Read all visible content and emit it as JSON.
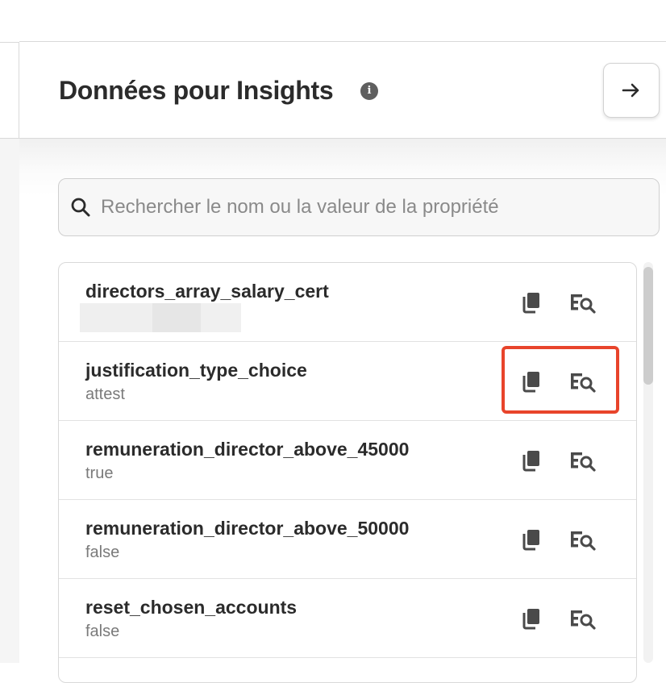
{
  "panel": {
    "title": "Données pour Insights",
    "info_glyph": "i",
    "collapse_icon": "arrow-right-icon"
  },
  "search": {
    "placeholder": "Rechercher le nom ou la valeur de la propriété",
    "value": ""
  },
  "properties": [
    {
      "name": "directors_array_salary_cert",
      "value": "",
      "value_redacted": true
    },
    {
      "name": "justification_type_choice",
      "value": "attest"
    },
    {
      "name": "remuneration_director_above_45000",
      "value": "true"
    },
    {
      "name": "remuneration_director_above_50000",
      "value": "false"
    },
    {
      "name": "reset_chosen_accounts",
      "value": "false"
    }
  ],
  "row_actions": {
    "copy_icon": "copy-icon",
    "inspect_icon": "inspect-icon"
  },
  "annotation": {
    "highlight_color": "#e8442b",
    "highlighted_row": "justification_type_choice"
  },
  "colors": {
    "text": "#2b2b2b",
    "muted": "#7a7a7a",
    "icon": "#4a4a4a"
  }
}
